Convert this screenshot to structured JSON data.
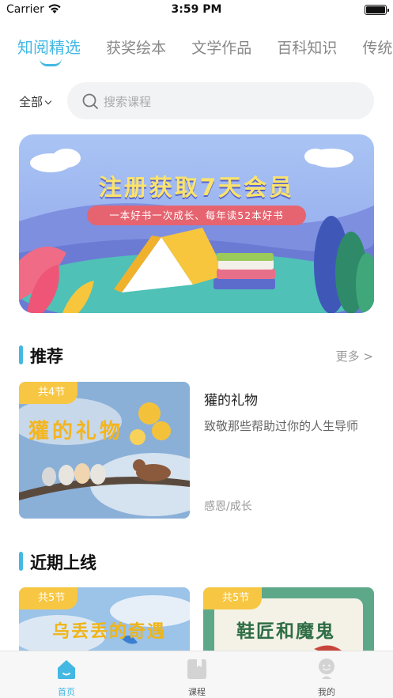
{
  "status_bar": {
    "carrier": "Carrier",
    "time": "3:59 PM"
  },
  "top_tabs": [
    {
      "label": "知阅精选",
      "active": true
    },
    {
      "label": "获奖绘本",
      "active": false
    },
    {
      "label": "文学作品",
      "active": false
    },
    {
      "label": "百科知识",
      "active": false
    },
    {
      "label": "传统",
      "active": false
    }
  ],
  "filter": {
    "label": "全部"
  },
  "search": {
    "placeholder": "搜索课程"
  },
  "banner": {
    "title": "注册获取7天会员",
    "subtitle": "一本好书一次成长、每年读52本好书"
  },
  "recommended": {
    "title": "推荐",
    "more_label": "更多 >",
    "course": {
      "badge": "共4节",
      "cover_text": "獾的礼物",
      "title": "獾的礼物",
      "description": "致敬那些帮助过你的人生导师",
      "tags": "感恩/成长"
    }
  },
  "recent": {
    "title": "近期上线",
    "courses": [
      {
        "badge": "共5节",
        "cover_text": "乌丢丢的奇遇"
      },
      {
        "badge": "共5节",
        "cover_text": "鞋匠和魔鬼"
      }
    ]
  },
  "bottom_nav": [
    {
      "label": "首页",
      "icon": "home-icon",
      "active": true
    },
    {
      "label": "课程",
      "icon": "book-icon",
      "active": false
    },
    {
      "label": "我的",
      "icon": "profile-icon",
      "active": false
    }
  ],
  "colors": {
    "accent": "#42b8e3",
    "badge": "#f7c743",
    "banner_pill": "#e66470"
  }
}
